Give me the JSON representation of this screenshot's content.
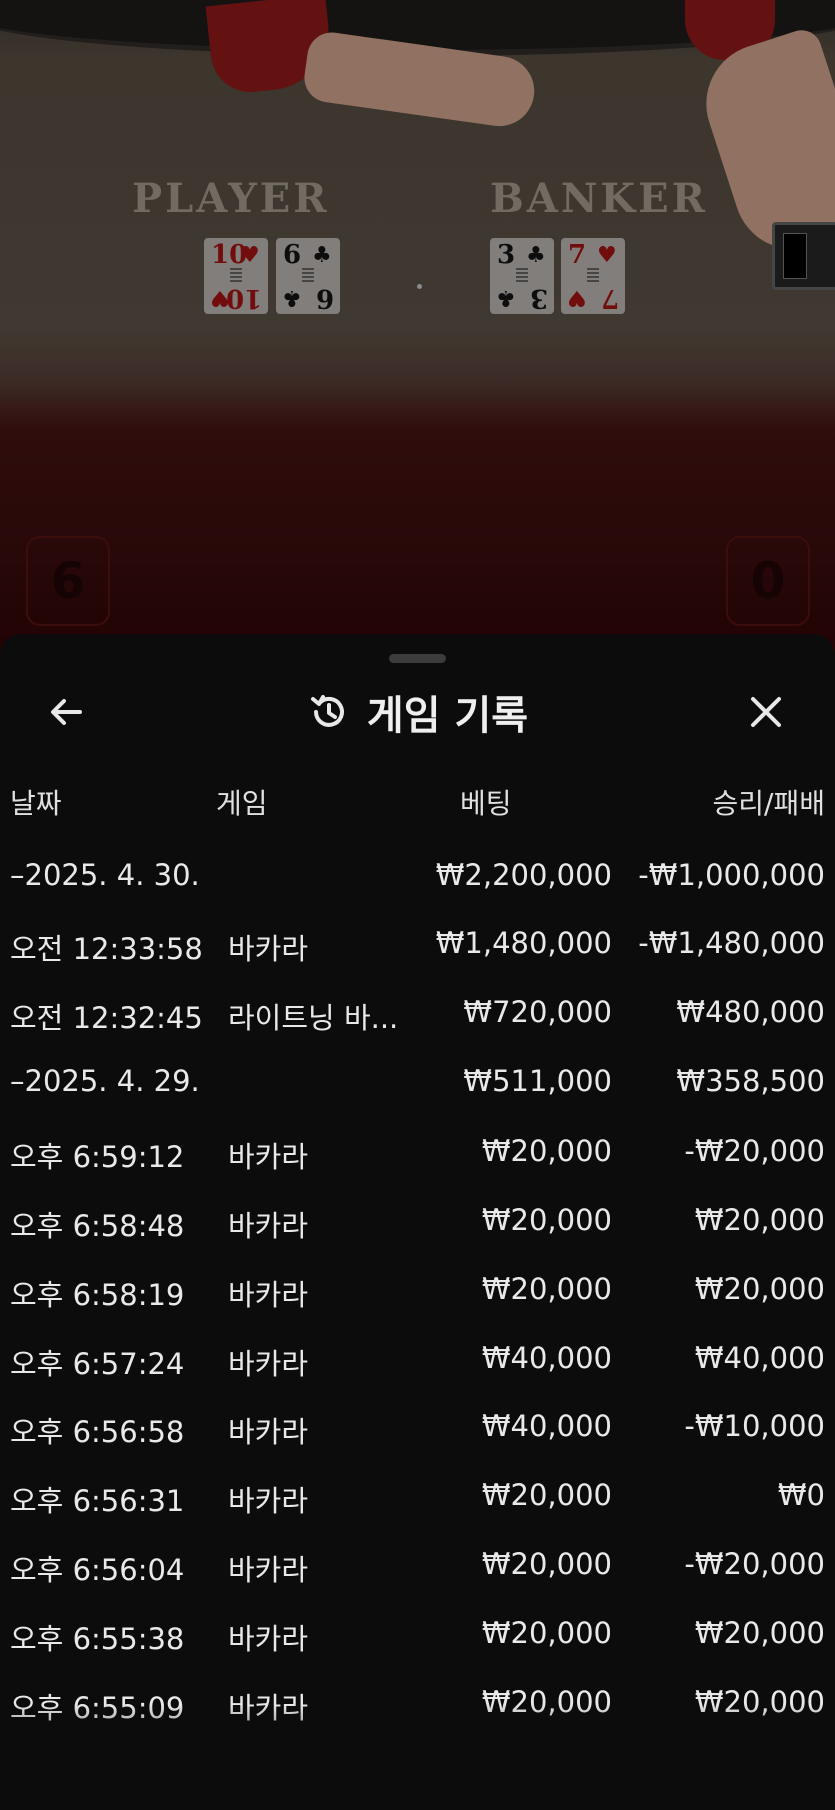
{
  "table": {
    "player_label": "PLAYER",
    "banker_label": "BANKER",
    "player_cards": [
      {
        "rank": "10",
        "suit": "♥",
        "color": "red"
      },
      {
        "rank": "6",
        "suit": "♣",
        "color": "black"
      }
    ],
    "banker_cards": [
      {
        "rank": "3",
        "suit": "♣",
        "color": "black"
      },
      {
        "rank": "7",
        "suit": "♥",
        "color": "red"
      }
    ],
    "player_score": "6",
    "banker_score": "0"
  },
  "sheet": {
    "title": "게임 기록",
    "back_icon": "arrow-left-icon",
    "history_icon": "history-icon",
    "close_icon": "close-icon"
  },
  "columns": {
    "date": "날짜",
    "game": "게임",
    "bet": "베팅",
    "win_loss": "승리/패배"
  },
  "groups": [
    {
      "date": "–2025. 4. 30.",
      "bet": "₩2,200,000",
      "win_loss": "-₩1,000,000"
    },
    {
      "date": "–2025. 4. 29.",
      "bet": "₩511,000",
      "win_loss": "₩358,500"
    }
  ],
  "rows": [
    {
      "time": "오전 12:33:58",
      "game": "바카라",
      "bet": "₩1,480,000",
      "win_loss": "-₩1,480,000"
    },
    {
      "time": "오전 12:32:45",
      "game": "라이트닝 바...",
      "bet": "₩720,000",
      "win_loss": "₩480,000"
    },
    {
      "time": "오후 6:59:12",
      "game": "바카라",
      "bet": "₩20,000",
      "win_loss": "-₩20,000"
    },
    {
      "time": "오후 6:58:48",
      "game": "바카라",
      "bet": "₩20,000",
      "win_loss": "₩20,000"
    },
    {
      "time": "오후 6:58:19",
      "game": "바카라",
      "bet": "₩20,000",
      "win_loss": "₩20,000"
    },
    {
      "time": "오후 6:57:24",
      "game": "바카라",
      "bet": "₩40,000",
      "win_loss": "₩40,000"
    },
    {
      "time": "오후 6:56:58",
      "game": "바카라",
      "bet": "₩40,000",
      "win_loss": "-₩10,000"
    },
    {
      "time": "오후 6:56:31",
      "game": "바카라",
      "bet": "₩20,000",
      "win_loss": "₩0"
    },
    {
      "time": "오후 6:56:04",
      "game": "바카라",
      "bet": "₩20,000",
      "win_loss": "-₩20,000"
    },
    {
      "time": "오후 6:55:38",
      "game": "바카라",
      "bet": "₩20,000",
      "win_loss": "₩20,000"
    },
    {
      "time": "오후 6:55:09",
      "game": "바카라",
      "bet": "₩20,000",
      "win_loss": "₩20,000"
    }
  ]
}
